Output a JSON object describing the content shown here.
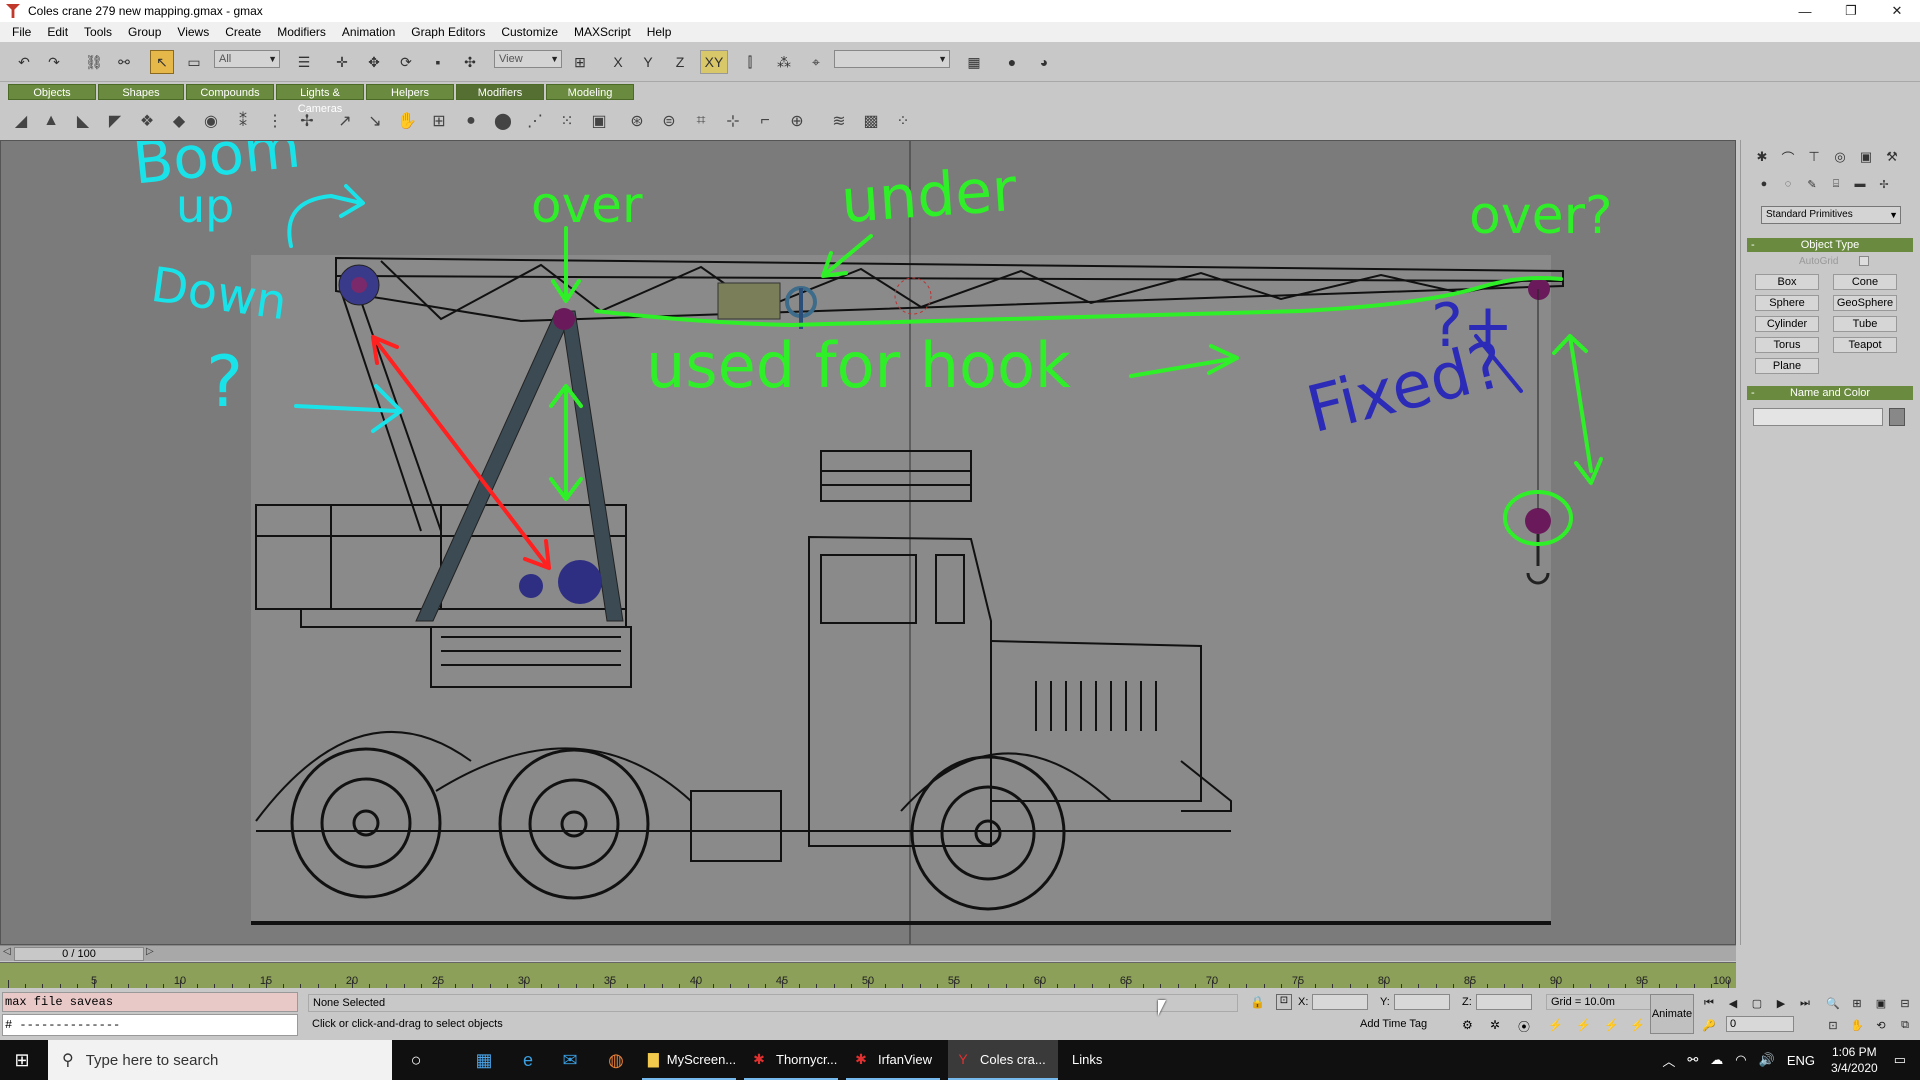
{
  "window": {
    "title": "Coles crane 279 new mapping.gmax - gmax",
    "min": "—",
    "max": "❐",
    "close": "✕"
  },
  "menu": [
    "File",
    "Edit",
    "Tools",
    "Group",
    "Views",
    "Create",
    "Modifiers",
    "Animation",
    "Graph Editors",
    "Customize",
    "MAXScript",
    "Help"
  ],
  "toolbar": {
    "filter_value": "All",
    "coord_value": "View",
    "named_sel_value": ""
  },
  "tabs": [
    "Objects",
    "Shapes",
    "Compounds",
    "Lights & Cameras",
    "Helpers",
    "Modifiers",
    "Modeling"
  ],
  "selected_tab": "Modifiers",
  "annotations": {
    "boom_up": "Boom",
    "up": "up",
    "down": "Down",
    "question_left": "?",
    "over_1": "over",
    "under": "under",
    "over_2": "over?",
    "used_for_hook": "used for hook",
    "fixed": "Fixed?",
    "fixed_mark": "?+"
  },
  "command_panel": {
    "dropdown": "Standard Primitives",
    "object_type_title": "Object Type",
    "autogrid": "AutoGrid",
    "primitives": [
      "Box",
      "Cone",
      "Sphere",
      "GeoSphere",
      "Cylinder",
      "Tube",
      "Torus",
      "Teapot",
      "Plane"
    ],
    "name_color_title": "Name and Color"
  },
  "timeline": {
    "frame_display": "0 / 100",
    "ticks": [
      "5",
      "10",
      "15",
      "20",
      "25",
      "30",
      "35",
      "40",
      "45",
      "50",
      "55",
      "60",
      "65",
      "70",
      "75",
      "80",
      "85",
      "90",
      "95",
      "100"
    ]
  },
  "status": {
    "script_line_1": "max file saveas",
    "script_line_2": "# --------------",
    "selection": "None Selected",
    "prompt": "Click or click-and-drag to select objects",
    "x_label": "X:",
    "y_label": "Y:",
    "z_label": "Z:",
    "grid": "Grid = 10.0m",
    "add_time_tag": "Add Time Tag",
    "animate": "Animate",
    "current_frame": "0"
  },
  "taskbar": {
    "search_placeholder": "Type here to search",
    "apps": [
      "MyScreen...",
      "Thornycr...",
      "IrfanView",
      "Coles cra..."
    ],
    "links": "Links",
    "lang": "ENG",
    "time": "1:06 PM",
    "date": "3/4/2020"
  },
  "colors": {
    "annotation_cyan": "#19e3e8",
    "annotation_green": "#2ff028",
    "annotation_red": "#ff2020",
    "annotation_blue": "#2b2bb8",
    "panel_green": "#6a8b3f"
  }
}
